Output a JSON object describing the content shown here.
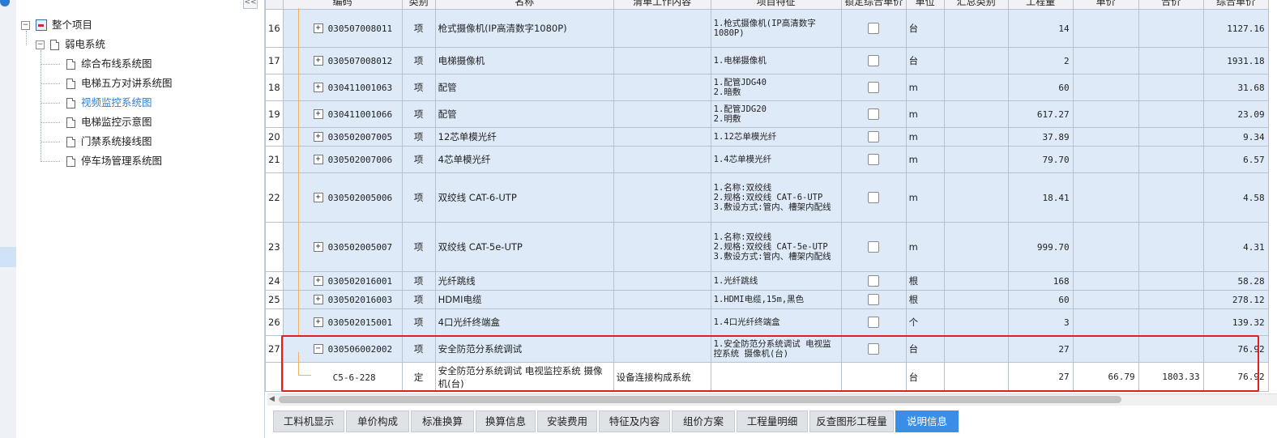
{
  "tree": {
    "root": "整个项目",
    "group": "弱电系统",
    "items": [
      "综合布线系统图",
      "电梯五方对讲系统图",
      "视频监控系统图",
      "电梯监控示意图",
      "门禁系统接线图",
      "停车场管理系统图"
    ],
    "selected_index": 2
  },
  "grid": {
    "columns": [
      "",
      "编码",
      "类别",
      "名称",
      "清单工作内容",
      "项目特征",
      "锁定综合单价",
      "单位",
      "汇总类别",
      "工程量",
      "单价",
      "合价",
      "综合单价"
    ],
    "rows": [
      {
        "no": "16",
        "code": "030507008011",
        "type": "项",
        "name": "枪式摄像机(IP高清数字1080P)",
        "work": "",
        "feature": "1.枪式摄像机(IP高清数字1080P)",
        "unit": "台",
        "qty": "14",
        "price": "",
        "total": "",
        "comp": "1127.16"
      },
      {
        "no": "17",
        "code": "030507008012",
        "type": "项",
        "name": "电梯摄像机",
        "work": "",
        "feature": "1.电梯摄像机",
        "unit": "台",
        "qty": "2",
        "price": "",
        "total": "",
        "comp": "1931.18"
      },
      {
        "no": "18",
        "code": "030411001063",
        "type": "项",
        "name": "配管",
        "work": "",
        "feature": "1.配管JDG40\n2.暗敷",
        "unit": "m",
        "qty": "60",
        "price": "",
        "total": "",
        "comp": "31.68"
      },
      {
        "no": "19",
        "code": "030411001066",
        "type": "项",
        "name": "配管",
        "work": "",
        "feature": "1.配管JDG20\n2.明敷",
        "unit": "m",
        "qty": "617.27",
        "price": "",
        "total": "",
        "comp": "23.09"
      },
      {
        "no": "20",
        "code": "030502007005",
        "type": "项",
        "name": "12芯单模光纤",
        "work": "",
        "feature": "1.12芯单模光纤",
        "unit": "m",
        "qty": "37.89",
        "price": "",
        "total": "",
        "comp": "9.34"
      },
      {
        "no": "21",
        "code": "030502007006",
        "type": "项",
        "name": "4芯单模光纤",
        "work": "",
        "feature": "1.4芯单模光纤",
        "unit": "m",
        "qty": "79.70",
        "price": "",
        "total": "",
        "comp": "6.57"
      },
      {
        "no": "22",
        "code": "030502005006",
        "type": "项",
        "name": "双绞线 CAT-6-UTP",
        "work": "",
        "feature": "1.名称:双绞线\n2.规格:双绞线 CAT-6-UTP\n3.敷设方式:管内、槽架内配线",
        "unit": "m",
        "qty": "18.41",
        "price": "",
        "total": "",
        "comp": "4.58"
      },
      {
        "no": "23",
        "code": "030502005007",
        "type": "项",
        "name": "双绞线 CAT-5e-UTP",
        "work": "",
        "feature": "1.名称:双绞线\n2.规格:双绞线 CAT-5e-UTP\n3.敷设方式:管内、槽架内配线",
        "unit": "m",
        "qty": "999.70",
        "price": "",
        "total": "",
        "comp": "4.31"
      },
      {
        "no": "24",
        "code": "030502016001",
        "type": "项",
        "name": "光纤跳线",
        "work": "",
        "feature": "1.光纤跳线",
        "unit": "根",
        "qty": "168",
        "price": "",
        "total": "",
        "comp": "58.28"
      },
      {
        "no": "25",
        "code": "030502016003",
        "type": "项",
        "name": "HDMI电缆",
        "work": "",
        "feature": "1.HDMI电缆,15m,黑色",
        "unit": "根",
        "qty": "60",
        "price": "",
        "total": "",
        "comp": "278.12"
      },
      {
        "no": "26",
        "code": "030502015001",
        "type": "项",
        "name": "4口光纤终端盒",
        "work": "",
        "feature": "1.4口光纤终端盒",
        "unit": "个",
        "qty": "3",
        "price": "",
        "total": "",
        "comp": "139.32"
      },
      {
        "no": "27",
        "code": "030506002002",
        "type": "项",
        "name": "安全防范分系统调试",
        "work": "",
        "feature": "1.安全防范分系统调试 电视监控系统 摄像机(台)",
        "unit": "台",
        "qty": "27",
        "price": "",
        "total": "",
        "comp": "76.92"
      },
      {
        "no": "",
        "code": "C5-6-228",
        "type": "定",
        "name": "安全防范分系统调试 电视监控系统 摄像机(台)",
        "work": "设备连接构成系统",
        "feature": "",
        "unit": "台",
        "qty": "27",
        "price": "66.79",
        "total": "1803.33",
        "comp": "76.92"
      }
    ]
  },
  "tabs": [
    "工料机显示",
    "单价构成",
    "标准换算",
    "换算信息",
    "安装费用",
    "特征及内容",
    "组价方案",
    "工程量明细",
    "反查图形工程量",
    "说明信息"
  ],
  "active_tab": 9,
  "colors": {
    "accent": "#3b8ee8",
    "row_bg": "#dfeaf8",
    "highlight_border": "#e02020"
  }
}
